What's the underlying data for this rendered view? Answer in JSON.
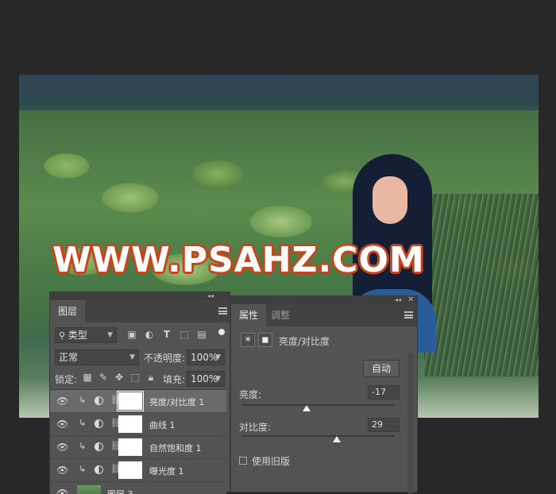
{
  "watermark": "WWW.PSAHZ.COM",
  "layers_panel": {
    "title": "图层",
    "filter_label": "类型",
    "blend_mode": "正常",
    "opacity_label": "不透明度:",
    "opacity_value": "100%",
    "lock_label": "锁定:",
    "fill_label": "填充:",
    "fill_value": "100%",
    "layers": [
      {
        "name": "亮度/对比度 1",
        "type": "adjustment",
        "selected": true
      },
      {
        "name": "曲线 1",
        "type": "adjustment",
        "selected": false
      },
      {
        "name": "自然饱和度 1",
        "type": "adjustment",
        "selected": false
      },
      {
        "name": "曝光度 1",
        "type": "adjustment",
        "selected": false
      },
      {
        "name": "图层 3",
        "type": "pixel",
        "selected": false
      }
    ]
  },
  "properties_panel": {
    "tab_active": "属性",
    "tab_inactive": "调整",
    "adjustment_title": "亮度/对比度",
    "auto_button": "自动",
    "brightness_label": "亮度:",
    "brightness_value": "-17",
    "brightness_slider_fraction": 0.42,
    "contrast_label": "对比度:",
    "contrast_value": "29",
    "contrast_slider_fraction": 0.62,
    "legacy_label": "使用旧版",
    "legacy_checked": false
  }
}
